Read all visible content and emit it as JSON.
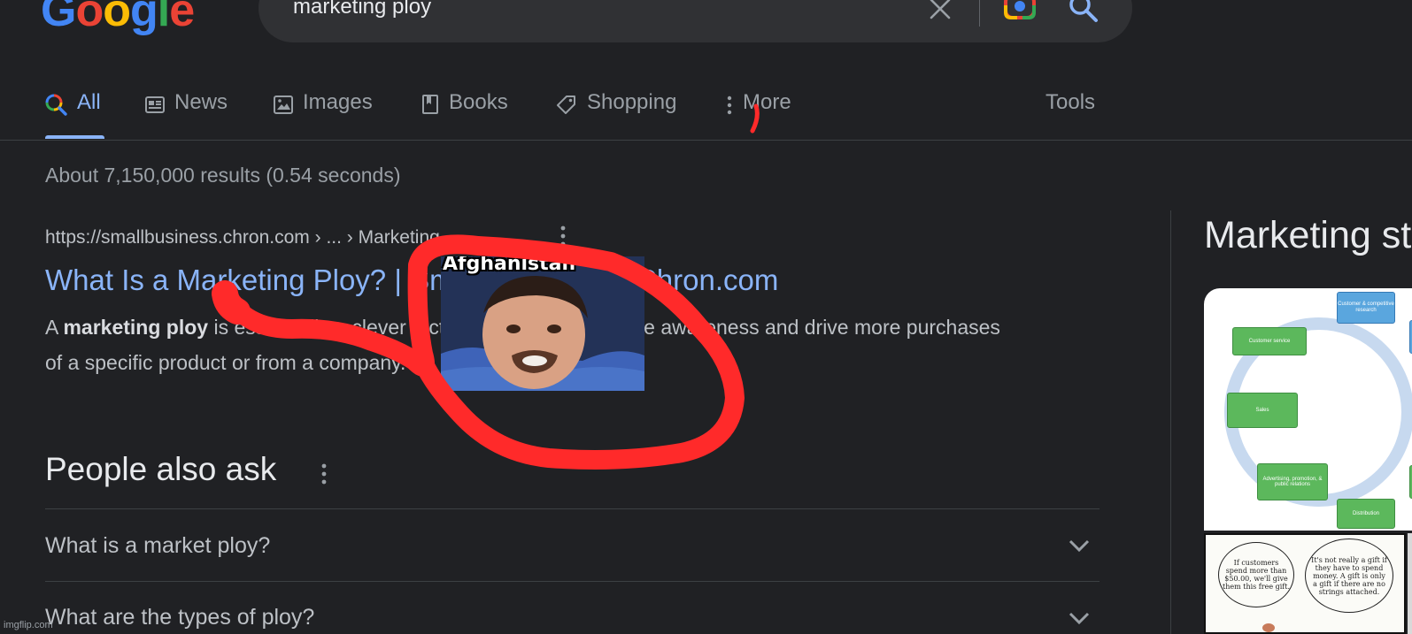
{
  "header": {
    "logo_letters": [
      {
        "ch": "G",
        "color": "#4285f4"
      },
      {
        "ch": "o",
        "color": "#ea4335"
      },
      {
        "ch": "o",
        "color": "#fbbc05"
      },
      {
        "ch": "g",
        "color": "#4285f4"
      },
      {
        "ch": "l",
        "color": "#34a853"
      },
      {
        "ch": "e",
        "color": "#ea4335"
      }
    ],
    "query": "marketing ploy"
  },
  "tabs": [
    {
      "label": "All",
      "icon": "multicolor-search-icon",
      "active": true
    },
    {
      "label": "News",
      "icon": "newspaper-icon"
    },
    {
      "label": "Images",
      "icon": "image-icon"
    },
    {
      "label": "Books",
      "icon": "book-icon"
    },
    {
      "label": "Shopping",
      "icon": "tag-icon"
    },
    {
      "label": "More",
      "icon": "kebab-menu-icon"
    },
    {
      "label": "Tools",
      "icon": ""
    }
  ],
  "stats": "About 7,150,000 results (0.54 seconds)",
  "result": {
    "url": "https://smallbusiness.chron.com › ... › Marketing",
    "title": "What Is a Marketing Ploy? | Small Business - Chron.com",
    "snippet_prefix": "A ",
    "snippet_bold": "marketing ploy",
    "snippet_rest": " is essentially a clever tactic by marketers to raise awareness and drive more purchases of a specific product or from a company."
  },
  "people_also_ask": {
    "title": "People also ask",
    "questions": [
      "What is a market ploy?",
      "What are the types of ploy?"
    ]
  },
  "knowledge_panel": {
    "title": "Marketing st",
    "diagram_boxes": {
      "customer_research": "Customer & competitive research",
      "customer_service": "Customer service",
      "sales": "Sales",
      "advertising": "Advertising, promotion, & public relations",
      "distribution": "Distribution"
    },
    "comic_bubble_1": "If customers spend more than $50.00, we'll give them this free gift.",
    "comic_bubble_2": "It's not really a gift if they have to spend money. A gift is only a gift if there are no strings attached."
  },
  "meme": {
    "caption": "Afghanistan"
  },
  "watermark": "imgflip.com",
  "colors": {
    "background": "#202124",
    "link": "#8ab4f8",
    "text": "#bdc1c6",
    "scribble": "#ff2a2a"
  }
}
